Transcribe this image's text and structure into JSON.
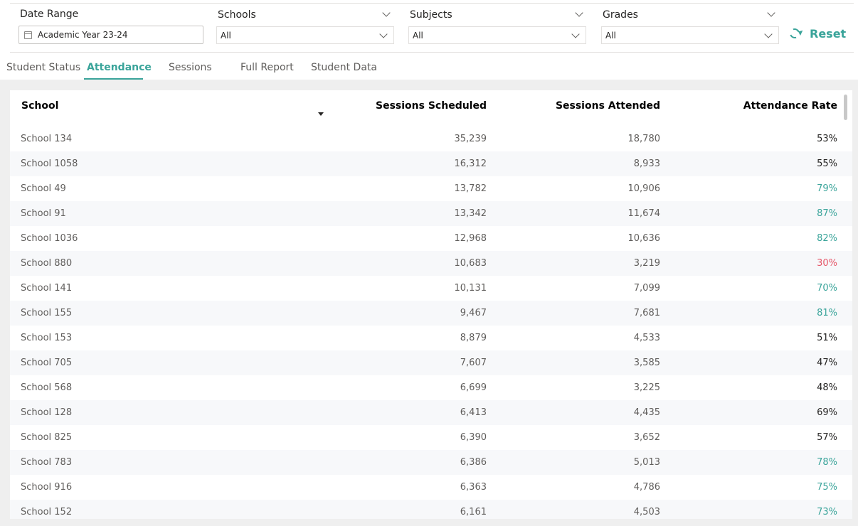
{
  "filters": {
    "date_range": {
      "label": "Date Range",
      "value": "Academic Year 23-24"
    },
    "schools": {
      "label": "Schools",
      "value": "All"
    },
    "subjects": {
      "label": "Subjects",
      "value": "All"
    },
    "grades": {
      "label": "Grades",
      "value": "All"
    },
    "reset_label": "Reset"
  },
  "tabs": [
    {
      "label": "Student Status"
    },
    {
      "label": "Attendance",
      "active": true
    },
    {
      "label": "Sessions"
    },
    {
      "label": "Full Report"
    },
    {
      "label": "Student Data"
    }
  ],
  "table": {
    "headers": {
      "school": "School",
      "sessions_scheduled": "Sessions Scheduled",
      "sessions_attended": "Sessions Attended",
      "attendance_rate": "Attendance Rate"
    },
    "sort": {
      "column": "school",
      "direction": "descending"
    },
    "rows": [
      {
        "school": "School 134",
        "scheduled": "35,239",
        "attended": "18,780",
        "rate": "53%",
        "status": "neutral"
      },
      {
        "school": "School 1058",
        "scheduled": "16,312",
        "attended": "8,933",
        "rate": "55%",
        "status": "neutral"
      },
      {
        "school": "School 49",
        "scheduled": "13,782",
        "attended": "10,906",
        "rate": "79%",
        "status": "good"
      },
      {
        "school": "School 91",
        "scheduled": "13,342",
        "attended": "11,674",
        "rate": "87%",
        "status": "good"
      },
      {
        "school": "School 1036",
        "scheduled": "12,968",
        "attended": "10,636",
        "rate": "82%",
        "status": "good"
      },
      {
        "school": "School 880",
        "scheduled": "10,683",
        "attended": "3,219",
        "rate": "30%",
        "status": "bad"
      },
      {
        "school": "School 141",
        "scheduled": "10,131",
        "attended": "7,099",
        "rate": "70%",
        "status": "good"
      },
      {
        "school": "School 155",
        "scheduled": "9,467",
        "attended": "7,681",
        "rate": "81%",
        "status": "good"
      },
      {
        "school": "School 153",
        "scheduled": "8,879",
        "attended": "4,533",
        "rate": "51%",
        "status": "neutral"
      },
      {
        "school": "School 705",
        "scheduled": "7,607",
        "attended": "3,585",
        "rate": "47%",
        "status": "neutral"
      },
      {
        "school": "School 568",
        "scheduled": "6,699",
        "attended": "3,225",
        "rate": "48%",
        "status": "neutral"
      },
      {
        "school": "School 128",
        "scheduled": "6,413",
        "attended": "4,435",
        "rate": "69%",
        "status": "neutral"
      },
      {
        "school": "School 825",
        "scheduled": "6,390",
        "attended": "3,652",
        "rate": "57%",
        "status": "neutral"
      },
      {
        "school": "School 783",
        "scheduled": "6,386",
        "attended": "5,013",
        "rate": "78%",
        "status": "good"
      },
      {
        "school": "School 916",
        "scheduled": "6,363",
        "attended": "4,786",
        "rate": "75%",
        "status": "good"
      },
      {
        "school": "School 152",
        "scheduled": "6,161",
        "attended": "4,503",
        "rate": "73%",
        "status": "good"
      }
    ]
  },
  "colors": {
    "accent": "#3aa49a",
    "good": "#3aa49a",
    "bad": "#e55769",
    "neutral": "#252423"
  }
}
